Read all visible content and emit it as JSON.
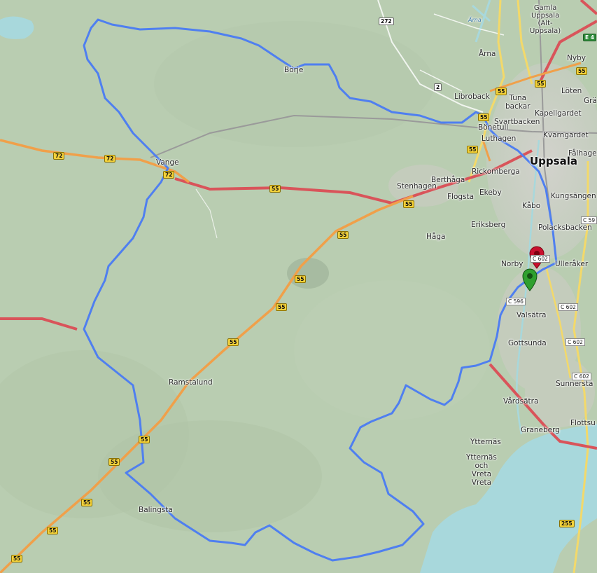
{
  "map": {
    "colors": {
      "terrain": "#b9cdb1",
      "water": "#a8d8dc",
      "route": "#4f7ff0",
      "highway": "#d9545a",
      "primary_road": "#f0a04a",
      "start_marker": "#2fa02f",
      "end_marker": "#c8102e"
    },
    "places": {
      "uppsala": "Uppsala",
      "gamla_uppsala": "Gamla\nUppsala\n(Alt-\nUppsala)",
      "arna": "Årna",
      "nyby": "Nyby",
      "loten": "Löten",
      "gra": "Grä",
      "libroback": "Libroback",
      "tuna_backar": "Tuna\nbackar",
      "kapellgardet": "Kapellgardet",
      "svartbacken": "Svartbacken",
      "bonetull": "Bönetull",
      "luthagen": "Luthagen",
      "kvarngardet": "Kvarngärdet",
      "falhage": "Fålhage",
      "borje": "Börje",
      "vange": "Vange",
      "rickomberga": "Rickomberga",
      "berthaga": "Berthåga",
      "stenhagen": "Stenhagen",
      "flogsta": "Flogsta",
      "ekeby": "Ekeby",
      "kungsangen": "Kungsängen",
      "kabo": "Kåbo",
      "eriksberg": "Eriksberg",
      "haga": "Håga",
      "polacksbacken": "Polacksbacken",
      "norby": "Norby",
      "ulleraker": "Ulleråker",
      "valsatra": "Valsätra",
      "gottsunda": "Gottsunda",
      "sunnersta": "Sunnersta",
      "vardsatra": "Vårdsätra",
      "graneberg": "Graneberg",
      "flottsund": "Flottsu",
      "ytternas": "Ytternäs",
      "ytternas_vreta": "Ytternäs\noch\nVreta\nVreta",
      "ramstalund": "Ramstalund",
      "balingsta": "Balingsta",
      "arna_river": "Ärna"
    },
    "road_shields": {
      "r272": "272",
      "r2": "2",
      "r72a": "72",
      "r72b": "72",
      "r72c": "72",
      "r55a": "55",
      "r55b": "55",
      "r55c": "55",
      "r55d": "55",
      "r55e": "55",
      "r55f": "55",
      "r55g": "55",
      "r55h": "55",
      "r55i": "55",
      "r55j": "55",
      "r55k": "55",
      "r55l": "55",
      "r255": "255",
      "e4": "E 4",
      "c602a": "C 602",
      "c602b": "C 602",
      "c602c": "C 602",
      "c602d": "C 602",
      "c59": "C 59",
      "c596": "C 596"
    },
    "markers": {
      "start": "start-marker",
      "end": "end-marker"
    }
  }
}
